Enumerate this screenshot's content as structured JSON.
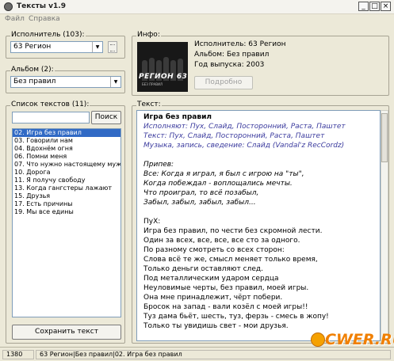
{
  "window": {
    "title": "Тексты v1.9",
    "min": "_",
    "max": "□",
    "close": "×"
  },
  "menu": [
    "Файл",
    "Справка"
  ],
  "artist": {
    "label": "Исполнитель (103):",
    "value": "63 Регион"
  },
  "album": {
    "label": "Альбом (2):",
    "value": "Без правил"
  },
  "info": {
    "label": "Инфо:",
    "artist_line": "Исполнитель: 63 Регион",
    "album_line": "Альбом: Без правил",
    "year_line": "Год выпуска: 2003",
    "more_button": "Подробно",
    "cover_logo": "РЕГИОН 63",
    "cover_sub": "БЕЗ ПРАВИЛ"
  },
  "song_list": {
    "label": "Список текстов (11):",
    "search_value": "",
    "search_button": "Поиск",
    "items": [
      "02. Игра без правил",
      "03. Говорили нам",
      "04. Вдохнём огня",
      "06. Помни меня",
      "07. Что нужно настоящему мужчи",
      "10. Дорога",
      "11. Я получу свободу",
      "13. Когда гангстеры лажают",
      "15. Друзья",
      "17. Есть причины",
      "19. Мы все едины"
    ],
    "selected_index": 0,
    "save_button": "Сохранить текст"
  },
  "lyrics": {
    "label": "Текст:",
    "lines": [
      {
        "text": "Игра без правил",
        "style": "title"
      },
      {
        "text": "Исполняют: Пух, Слайд, Посторонний, Раста, Паштет",
        "style": "credit"
      },
      {
        "text": "Текст: Пух, Слайд, Посторонний, Раста, Паштет",
        "style": "credit"
      },
      {
        "text": "Музыка, запись, сведение: Слайд (Vandal'z RecCordz)",
        "style": "credit"
      },
      {
        "text": "",
        "style": "normal"
      },
      {
        "text": "Припев:",
        "style": "italic"
      },
      {
        "text": "Все: Когда я играл, я был с игрою на \"ты\",",
        "style": "italic"
      },
      {
        "text": "Когда побеждал - воплощались мечты.",
        "style": "italic"
      },
      {
        "text": "Что проиграл, то всё позабыл,",
        "style": "italic"
      },
      {
        "text": "Забыл, забыл, забыл, забыл...",
        "style": "italic"
      },
      {
        "text": "",
        "style": "normal"
      },
      {
        "text": "ПуХ:",
        "style": "normal"
      },
      {
        "text": "Игра без правил, по чести без скромной лести.",
        "style": "normal"
      },
      {
        "text": "Один за всех, все, все, все сто за одного.",
        "style": "normal"
      },
      {
        "text": "По разному смотреть со всех сторон:",
        "style": "normal"
      },
      {
        "text": "Слова всё те же, смысл меняет только время,",
        "style": "normal"
      },
      {
        "text": "Только деньги оставляют след.",
        "style": "normal"
      },
      {
        "text": "Под металлическим ударом сердца",
        "style": "normal"
      },
      {
        "text": "Неуловимые черты, без правил, моей игры.",
        "style": "normal"
      },
      {
        "text": "Она мне принадлежит, чёрт побери.",
        "style": "normal"
      },
      {
        "text": "Бросок на запад - вали козёл с моей игры!!",
        "style": "normal"
      },
      {
        "text": "Туз дама бьёт, шесть, туз, ферзь - смесь в жопу!",
        "style": "normal"
      },
      {
        "text": "Только ты увидишь свет - мои друзья.",
        "style": "normal"
      }
    ]
  },
  "status": {
    "count": "1380",
    "path": "63 Регион|Без правил|02. Игра без правил"
  },
  "watermark": "CWER.RU",
  "colors": {
    "selection": "#316ac5",
    "credit": "#3b3b9e",
    "watermark": "#f07f00"
  }
}
